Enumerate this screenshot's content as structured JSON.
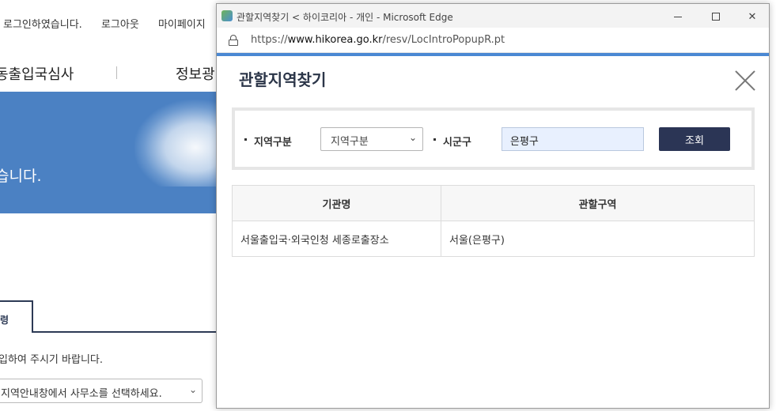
{
  "background_page": {
    "topbar": {
      "login_status": "로그인하였습니다.",
      "logout": "로그아웃",
      "mypage": "마이페이지"
    },
    "nav": {
      "item1": "동출입국심사",
      "item2": "정보광"
    },
    "banner_text": "습니다.",
    "tab_label": "령",
    "instruction": "입하여 주시기 바랍니다.",
    "office_select": "지역안내창에서 사무소를 선택하세요."
  },
  "window": {
    "title": "관할지역찾기 < 하이코리아 - 개인 - Microsoft Edge",
    "url_prefix": "https://",
    "url_host": "www.hikorea.go.kr",
    "url_path": "/resv/LocIntroPopupR.pt",
    "controls": {
      "minimize": "minimize-icon",
      "maximize": "maximize-icon",
      "close": "close-icon"
    }
  },
  "popup": {
    "title": "관할지역찾기",
    "search": {
      "region_label": "지역구분",
      "region_selected": "지역구분",
      "sigungu_label": "시군구",
      "sigungu_value": "은평구",
      "search_button": "조회"
    },
    "table": {
      "headers": [
        "기관명",
        "관할구역"
      ],
      "rows": [
        [
          "서울출입국·외국인청 세종로출장소",
          "서울(은평구)"
        ]
      ]
    }
  },
  "colors": {
    "accent": "#4a88d3",
    "button": "#2b3555",
    "banner": "#4b81c3"
  }
}
